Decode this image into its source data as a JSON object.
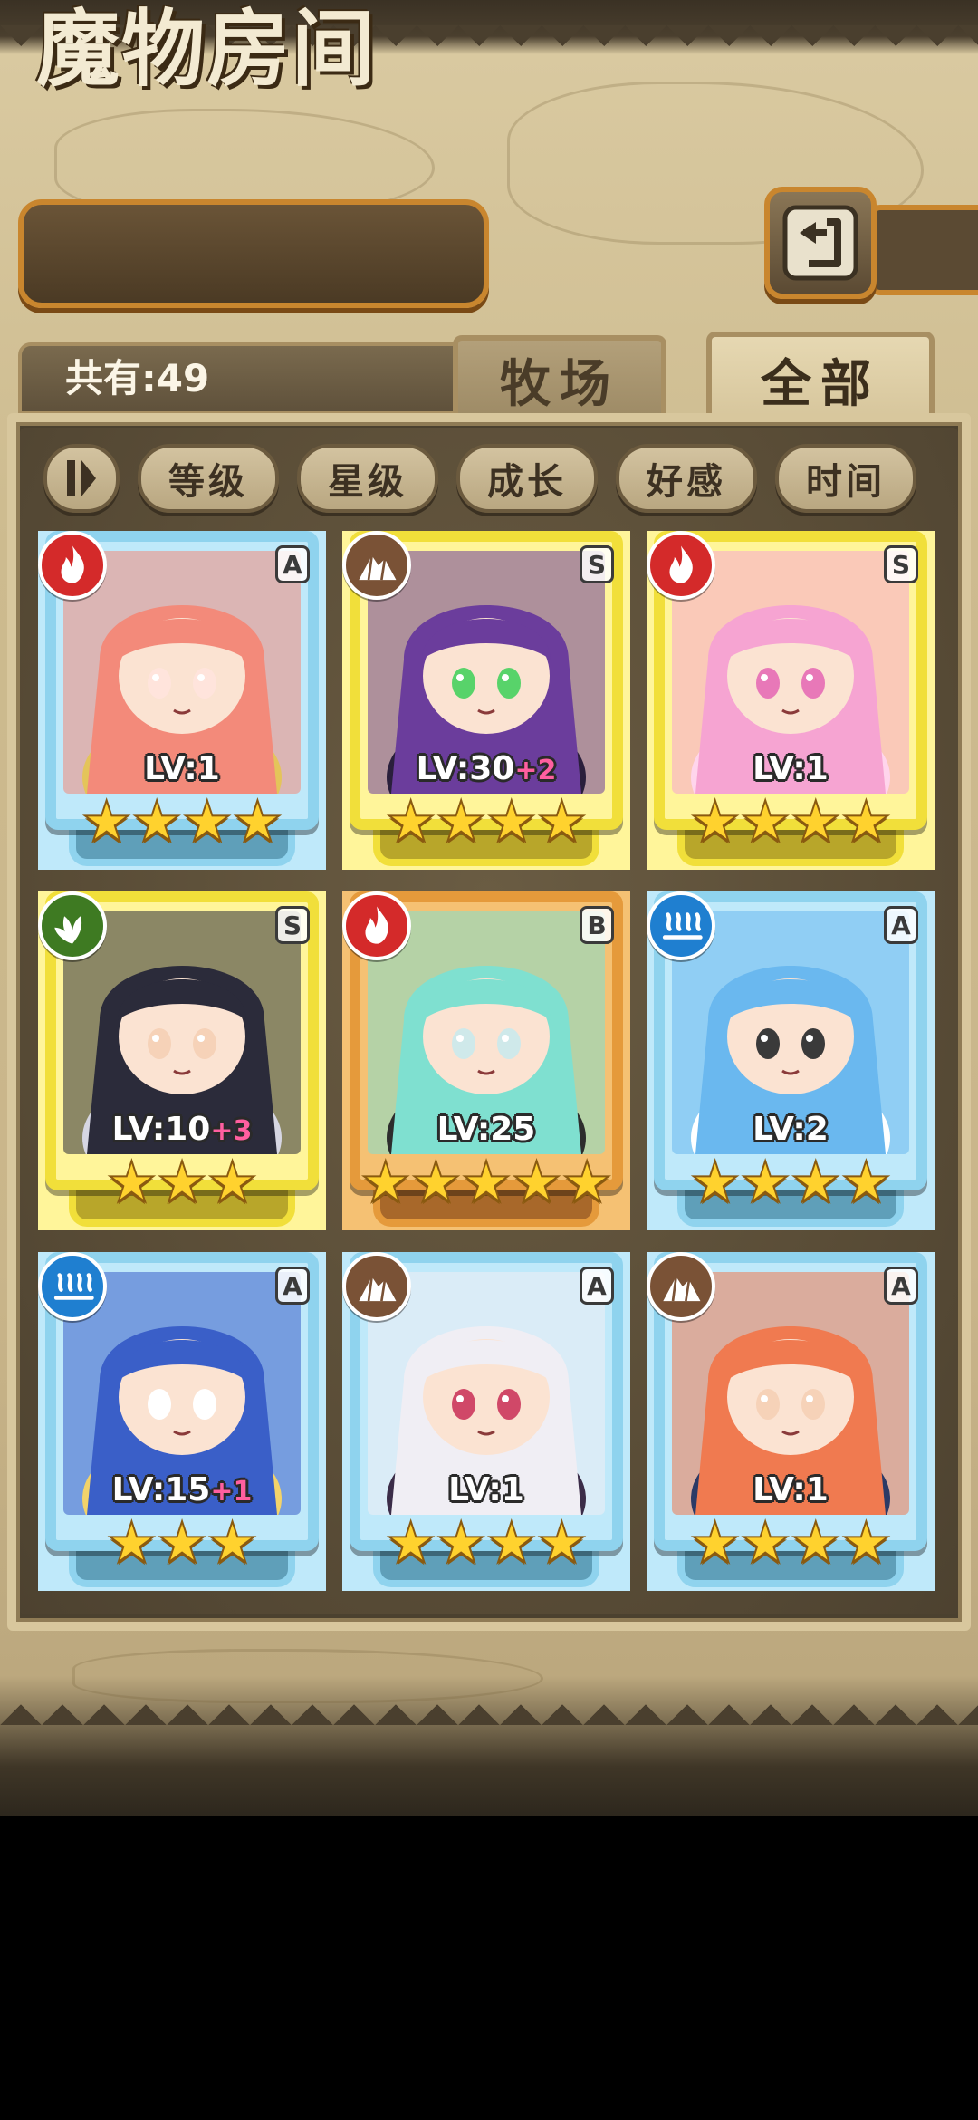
{
  "header": {
    "title": "魔物房间",
    "back_icon": "return-arrow-icon"
  },
  "summary": {
    "total_label": "共有:49"
  },
  "tabs": [
    {
      "label": "牧场",
      "selected": false
    },
    {
      "label": "全部",
      "selected": true
    }
  ],
  "sort": {
    "toggle_icon": "sort-order-icon",
    "buttons": [
      "等级",
      "星级",
      "成长",
      "好感",
      "时间"
    ]
  },
  "monsters": [
    {
      "element": "fire",
      "rank": "A",
      "level": "LV:1",
      "bonus": "",
      "stars": 4,
      "frame": "a",
      "palette": [
        "#f38a7a",
        "#e4c45a",
        "#ffe4dc"
      ]
    },
    {
      "element": "earth",
      "rank": "S",
      "level": "LV:30",
      "bonus": "+2",
      "stars": 4,
      "frame": "s",
      "palette": [
        "#6b3d9c",
        "#2a1f3c",
        "#58d36a"
      ]
    },
    {
      "element": "fire",
      "rank": "S",
      "level": "LV:1",
      "bonus": "",
      "stars": 4,
      "frame": "s",
      "palette": [
        "#f6a4d2",
        "#ffd5ec",
        "#e878b8"
      ]
    },
    {
      "element": "wood",
      "rank": "S",
      "level": "LV:10",
      "bonus": "+3",
      "stars": 3,
      "frame": "s",
      "palette": [
        "#2b2b3a",
        "#d6d6e2",
        "#f6d2b8"
      ]
    },
    {
      "element": "fire",
      "rank": "B",
      "level": "LV:25",
      "bonus": "",
      "stars": 5,
      "frame": "b",
      "palette": [
        "#7fe0d0",
        "#2d2d2d",
        "#cfe9ea"
      ]
    },
    {
      "element": "water",
      "rank": "A",
      "level": "LV:2",
      "bonus": "",
      "stars": 4,
      "frame": "a",
      "palette": [
        "#6ab8ef",
        "#ffffff",
        "#3a3a3a"
      ]
    },
    {
      "element": "water",
      "rank": "A",
      "level": "LV:15",
      "bonus": "+1",
      "stars": 3,
      "frame": "a",
      "palette": [
        "#3a5fc8",
        "#f3d36a",
        "#ffffff"
      ]
    },
    {
      "element": "earth",
      "rank": "A",
      "level": "LV:1",
      "bonus": "",
      "stars": 4,
      "frame": "a",
      "palette": [
        "#f0eef4",
        "#3b2c48",
        "#d04868"
      ]
    },
    {
      "element": "earth",
      "rank": "A",
      "level": "LV:1",
      "bonus": "",
      "stars": 4,
      "frame": "a",
      "palette": [
        "#f07a50",
        "#2b3a66",
        "#f6d2b8"
      ]
    }
  ],
  "colors": {
    "fire": "#d42a2a",
    "earth": "#7a5236",
    "wood": "#3e7a22",
    "water": "#1f7fd0"
  }
}
